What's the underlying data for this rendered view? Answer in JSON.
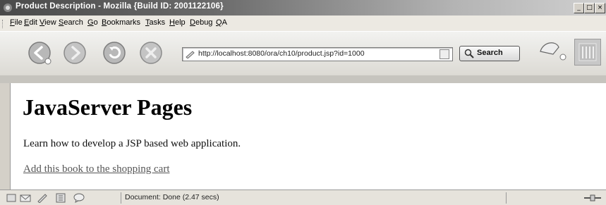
{
  "window": {
    "title": "Product Description - Mozilla {Build ID: 2001122106}",
    "controls": {
      "minimize": "_",
      "maximize": "□",
      "close": "×"
    }
  },
  "menu": [
    "File",
    "Edit",
    "View",
    "Search",
    "Go",
    "Bookmarks",
    "Tasks",
    "Help",
    "Debug",
    "QA"
  ],
  "toolbar": {
    "buttons": [
      "back-icon",
      "forward-icon",
      "reload-icon",
      "stop-icon"
    ],
    "url": "http://localhost:8080/ora/ch10/product.jsp?id=1000",
    "search_label": "Search"
  },
  "page": {
    "heading": "JavaServer Pages",
    "description": "Learn how to develop a JSP based web application.",
    "link_text": "Add this book to the shopping cart"
  },
  "status": {
    "text": "Document: Done (2.47 secs)",
    "icons": [
      "navigator-icon",
      "mail-icon",
      "composer-icon",
      "addressbook-icon",
      "irc-icon"
    ]
  },
  "colors": {
    "titlebar_dark": "#4a4a4a",
    "link": "#555555"
  }
}
